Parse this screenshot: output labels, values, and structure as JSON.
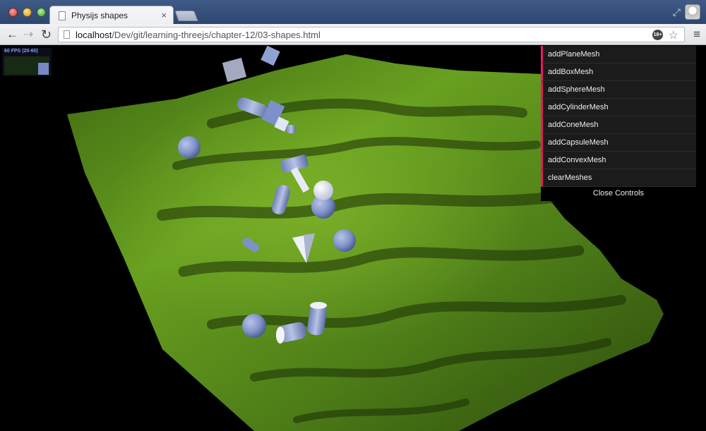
{
  "window": {
    "tab_title": "Physijs shapes",
    "tab_close": "×"
  },
  "toolbar": {
    "url_host": "localhost",
    "url_path": "/Dev/git/learning-threejs/chapter-12/03-shapes.html",
    "extension_badge": "18+",
    "back_icon": "back-arrow-icon",
    "forward_icon": "forward-arrow-icon",
    "reload_icon": "reload-icon",
    "star_icon": "bookmark-star-icon",
    "menu_icon": "hamburger-menu-icon"
  },
  "stats": {
    "label": "60 FPS (20-60)"
  },
  "gui": {
    "items": [
      {
        "label": "addPlaneMesh"
      },
      {
        "label": "addBoxMesh"
      },
      {
        "label": "addSphereMesh"
      },
      {
        "label": "addCylinderMesh"
      },
      {
        "label": "addConeMesh"
      },
      {
        "label": "addCapsuleMesh"
      },
      {
        "label": "addConvexMesh"
      },
      {
        "label": "clearMeshes"
      }
    ],
    "close_label": "Close Controls",
    "accent_color": "#e61d5f"
  },
  "colors": {
    "chrome_blue": "#2d4670",
    "terrain_green": "#5f9a1e",
    "mesh_blue": "#8092c8",
    "mesh_white": "#e6e9f2"
  }
}
